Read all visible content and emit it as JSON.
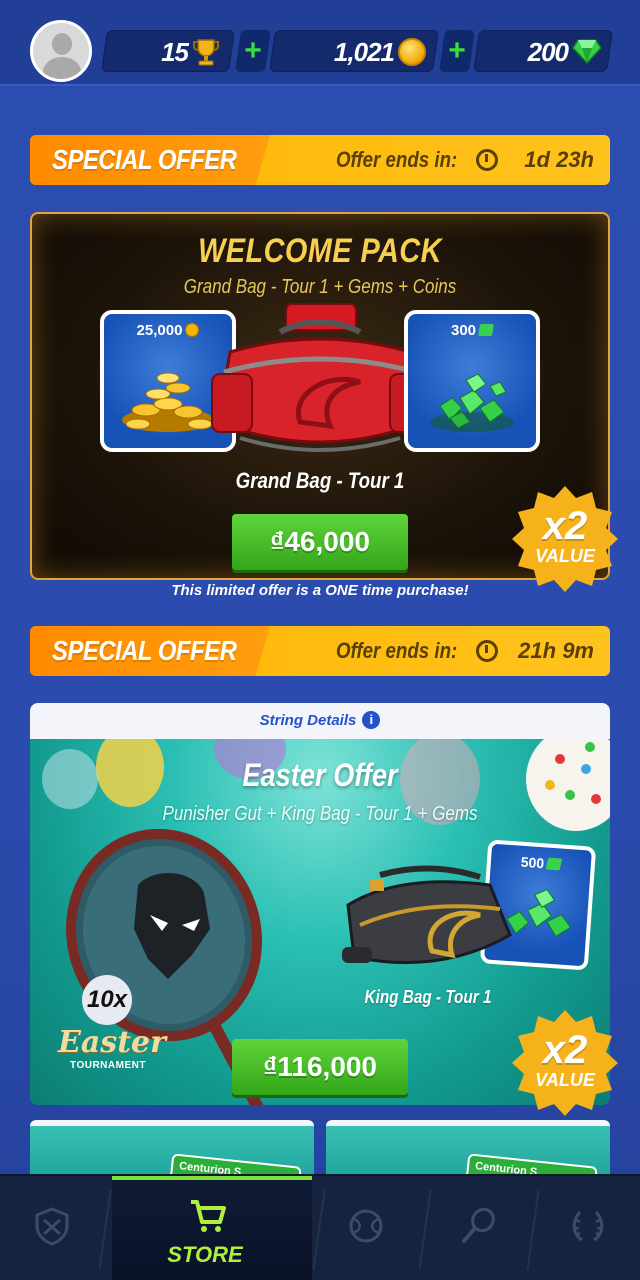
{
  "top_bar": {
    "trophies": "15",
    "coins": "1,021",
    "gems": "200",
    "plus_label": "+"
  },
  "offer1": {
    "title": "SPECIAL OFFER",
    "ends_label": "Offer ends in:",
    "timer": "1d 23h"
  },
  "welcome_pack": {
    "title": "WELCOME PACK",
    "subtitle": "Grand Bag - Tour 1 + Gems + Coins",
    "coins_amount": "25,000",
    "gems_amount": "300",
    "bag_label": "Grand Bag - Tour 1",
    "price": "₫46,000",
    "badge_multiplier": "x2",
    "badge_label": "VALUE"
  },
  "one_time_notice": "This limited offer is a ONE time purchase!",
  "offer2": {
    "title": "SPECIAL OFFER",
    "ends_label": "Offer ends in:",
    "timer": "21h 9m"
  },
  "easter_offer": {
    "header": "String Details",
    "info_glyph": "i",
    "title": "Easter Offer",
    "subtitle": "Punisher Gut + King Bag - Tour 1 + Gems",
    "string_qty": "10x",
    "gems_amount": "500",
    "bag_label": "King Bag - Tour 1",
    "logo_script": "Easter",
    "logo_sub": "TOURNAMENT",
    "price": "₫116,000",
    "badge_multiplier": "x2",
    "badge_label": "VALUE"
  },
  "mini_cards": {
    "left_label": "Centurion S",
    "right_label": "Centurion S"
  },
  "bottom_nav": {
    "store_label": "STORE",
    "active": "store"
  },
  "colors": {
    "accent_green": "#33a61a",
    "banner_orange": "#ff8a00",
    "banner_yellow": "#ffc31e",
    "background_blue": "#2b4cae",
    "nav_active": "#aef03b"
  }
}
